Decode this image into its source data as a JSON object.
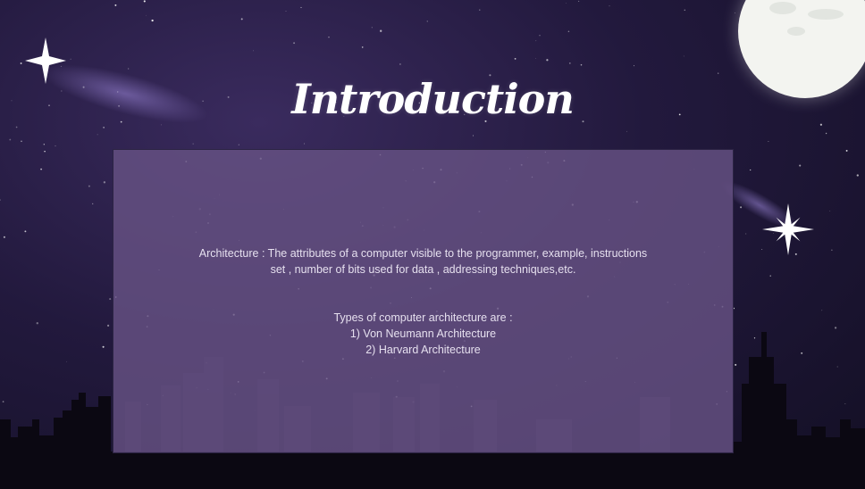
{
  "slide": {
    "title": "Introduction",
    "architecture_line1": "Architecture : The attributes of a  computer visible to the programmer, example, instructions",
    "architecture_line2": "set , number of bits used for data , addressing techniques,etc.",
    "types_heading": "Types of computer architecture are :",
    "types": [
      "1) Von  Neumann Architecture",
      "2) Harvard Architecture"
    ]
  },
  "decor": {
    "moon": "moon-icon",
    "sparkles": [
      "sparkle-star-icon",
      "sparkle-star-icon"
    ],
    "skyline": "city-skyline-silhouette"
  },
  "colors": {
    "sky": "#22193d",
    "box": "#665284",
    "text": "#e6e0ef",
    "title": "#ffffff"
  }
}
